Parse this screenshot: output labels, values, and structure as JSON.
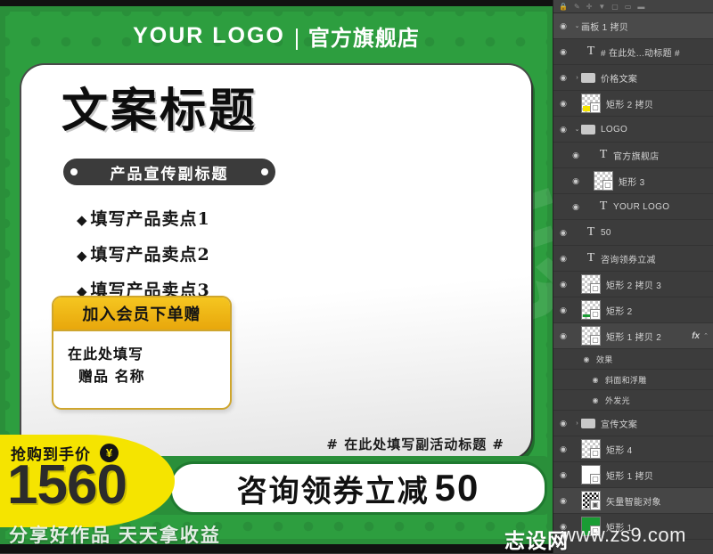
{
  "poster": {
    "brand_en": "YOUR LOGO",
    "brand_cn": "官方旗舰店",
    "headline": "文案标题",
    "subtitle": "产品宣传副标题",
    "bullets": [
      {
        "marker": "◆",
        "text": "填写产品卖点1"
      },
      {
        "marker": "◆",
        "text": "填写产品卖点2"
      },
      {
        "marker": "◆",
        "text": "填写产品卖点3"
      }
    ],
    "gift": {
      "header": "加入会员下单赠",
      "line1": "在此处填写",
      "line2": "赠品 名称"
    },
    "sub_activity_title": "# 在此处填写副活动标题 #",
    "price_tag": {
      "label": "抢购到手价",
      "currency": "¥",
      "amount": "1560"
    },
    "coupon": {
      "text": "咨询领券立减",
      "amount": "50"
    },
    "colors": {
      "green": "#2d9e3f",
      "green_dark": "#2a8f3a",
      "yellow": "#f5e400",
      "gift_yellow": "#e8a70c"
    }
  },
  "watermarks": {
    "slogan": "分享好作品 天天拿收益",
    "site_cn": "志设网",
    "site_url": "www.zs9.com",
    "big_glyph": "志"
  },
  "panel": {
    "toolbar_icons": [
      "lock-icon",
      "brush-icon",
      "move-icon",
      "shape-icon",
      "frame-icon",
      "opacity-icon",
      "fill-icon"
    ],
    "layers": [
      {
        "name": "画板 1 拷贝",
        "type": "group",
        "icon": "none",
        "indent": 0,
        "visible": true,
        "expanded": true,
        "selected": true,
        "fx": false
      },
      {
        "name": "# 在此处...动标题 #",
        "type": "text",
        "icon": "text-icon",
        "indent": 1,
        "visible": true,
        "expanded": false,
        "selected": false,
        "fx": false
      },
      {
        "name": "价格文案",
        "type": "folder",
        "icon": "folder-icon",
        "indent": 1,
        "visible": true,
        "expanded": false,
        "selected": false,
        "fx": false
      },
      {
        "name": "矩形 2 拷贝",
        "type": "shape",
        "icon": "thumb-yellow",
        "indent": 1,
        "visible": true,
        "expanded": false,
        "selected": false,
        "fx": false
      },
      {
        "name": "LOGO",
        "type": "folder",
        "icon": "folder-icon",
        "indent": 1,
        "visible": true,
        "expanded": true,
        "selected": false,
        "fx": false
      },
      {
        "name": "官方旗舰店",
        "type": "text",
        "icon": "text-icon",
        "indent": 2,
        "visible": true,
        "expanded": false,
        "selected": false,
        "fx": false
      },
      {
        "name": "矩形 3",
        "type": "shape",
        "icon": "thumb-trans",
        "indent": 2,
        "visible": true,
        "expanded": false,
        "selected": false,
        "fx": false
      },
      {
        "name": "YOUR LOGO",
        "type": "text",
        "icon": "text-icon",
        "indent": 2,
        "visible": true,
        "expanded": false,
        "selected": false,
        "fx": false
      },
      {
        "name": "50",
        "type": "text",
        "icon": "text-icon",
        "indent": 1,
        "visible": true,
        "expanded": false,
        "selected": false,
        "fx": false
      },
      {
        "name": "咨询领券立减",
        "type": "text",
        "icon": "text-icon",
        "indent": 1,
        "visible": true,
        "expanded": false,
        "selected": false,
        "fx": false
      },
      {
        "name": "矩形 2 拷贝 3",
        "type": "shape",
        "icon": "thumb-trans",
        "indent": 1,
        "visible": true,
        "expanded": false,
        "selected": false,
        "fx": false
      },
      {
        "name": "矩形 2",
        "type": "shape",
        "icon": "thumb-green",
        "indent": 1,
        "visible": true,
        "expanded": false,
        "selected": false,
        "fx": false
      },
      {
        "name": "矩形 1 拷贝 2",
        "type": "shape",
        "icon": "thumb-trans",
        "indent": 1,
        "visible": true,
        "expanded": false,
        "selected": false,
        "fx": true
      },
      {
        "name": "效果",
        "type": "effects",
        "icon": "none",
        "indent": 2,
        "visible": true,
        "expanded": false,
        "selected": false,
        "fx": false
      },
      {
        "name": "斜面和浮雕",
        "type": "effect",
        "icon": "none",
        "indent": 3,
        "visible": true,
        "expanded": false,
        "selected": false,
        "fx": false
      },
      {
        "name": "外发光",
        "type": "effect",
        "icon": "none",
        "indent": 3,
        "visible": true,
        "expanded": false,
        "selected": false,
        "fx": false
      },
      {
        "name": "宣传文案",
        "type": "folder",
        "icon": "folder-icon",
        "indent": 1,
        "visible": true,
        "expanded": false,
        "selected": false,
        "fx": false
      },
      {
        "name": "矩形 4",
        "type": "shape",
        "icon": "thumb-trans",
        "indent": 1,
        "visible": true,
        "expanded": false,
        "selected": false,
        "fx": false
      },
      {
        "name": "矩形 1 拷贝",
        "type": "shape",
        "icon": "thumb-white",
        "indent": 1,
        "visible": true,
        "expanded": false,
        "selected": false,
        "fx": false
      },
      {
        "name": "矢量智能对象",
        "type": "smart",
        "icon": "thumb-qr",
        "indent": 1,
        "visible": true,
        "expanded": false,
        "selected": false,
        "fx": false
      },
      {
        "name": "矩形 1",
        "type": "shape",
        "icon": "thumb-green",
        "indent": 1,
        "visible": true,
        "expanded": false,
        "selected": false,
        "fx": false
      }
    ],
    "fx_label": "fx",
    "eye_glyph": "◉",
    "chevron_down": "⌄",
    "chevron_right": "›",
    "text_layer_glyph": "T"
  }
}
